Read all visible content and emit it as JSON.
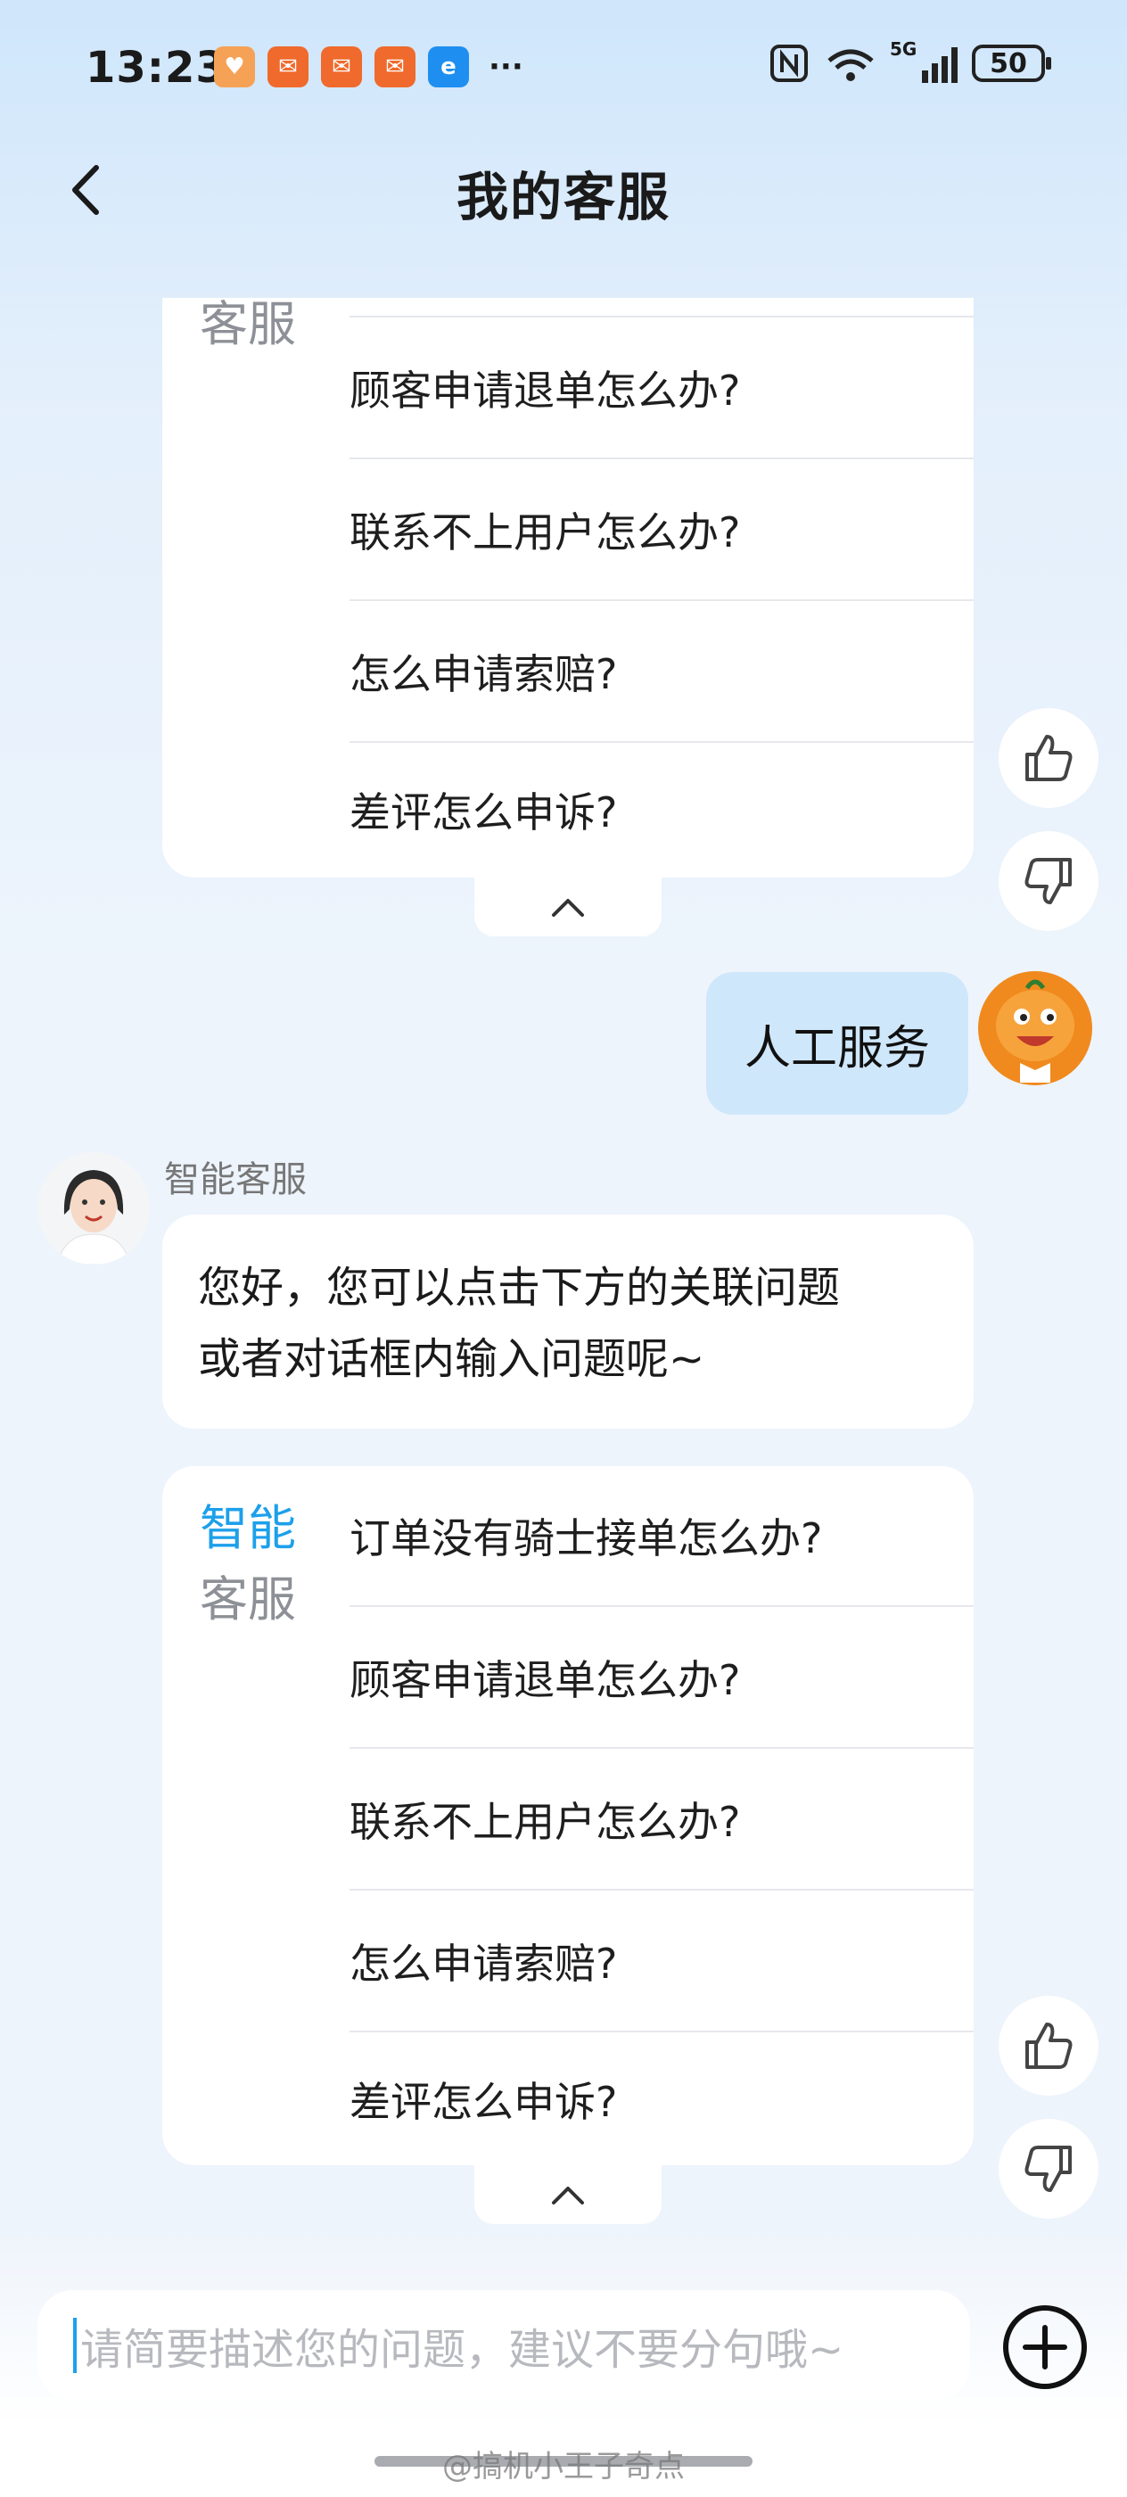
{
  "status_bar": {
    "time": "13:23",
    "network": "5G",
    "battery": "50"
  },
  "header": {
    "title": "我的客服"
  },
  "top_card": {
    "side_label_bottom": "客服",
    "items": [
      "顾客申请退单怎么办?",
      "联系不上用户怎么办?",
      "怎么申请索赔?",
      "差评怎么申诉?"
    ]
  },
  "user_message": {
    "text": "人工服务"
  },
  "bot": {
    "name": "智能客服",
    "message": [
      "您好，您可以点击下方的关联问题",
      "或者对话框内输入问题呢~"
    ]
  },
  "bottom_card": {
    "side_label_top": "智能",
    "side_label_bottom": "客服",
    "items": [
      "订单没有骑士接单怎么办?",
      "顾客申请退单怎么办?",
      "联系不上用户怎么办?",
      "怎么申请索赔?",
      "差评怎么申诉?"
    ]
  },
  "input": {
    "placeholder": "请简要描述您的问题，建议不要分句哦~"
  },
  "watermark": "@搞机小王子奇点",
  "colors": {
    "accent": "#1da0ea",
    "user_bubble": "#cfe7fa"
  }
}
